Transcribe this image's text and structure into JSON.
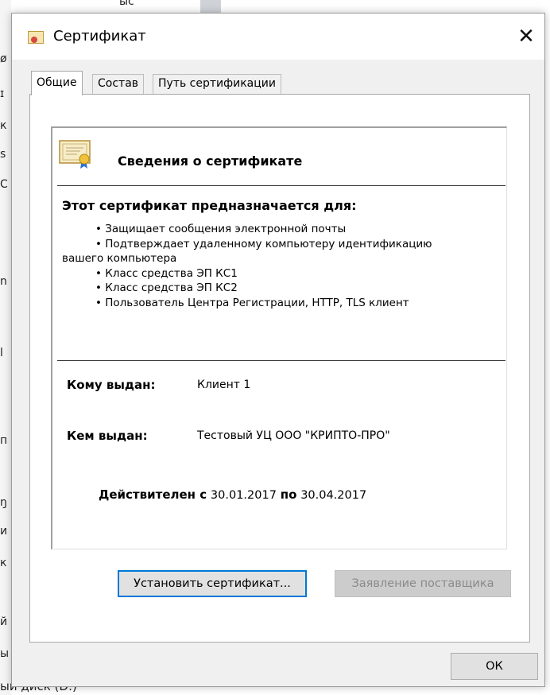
{
  "background": {
    "top_fragment": "ыс",
    "left_fragments": [
      "ø",
      "ɪ",
      "к",
      "s",
      "C",
      "n",
      "l",
      "п",
      "ŋ",
      "и",
      "к",
      "й",
      "ы"
    ],
    "bottom_text": "ый диск (D:)"
  },
  "dialog": {
    "title": "Сертификат",
    "icon": "certificate-icon",
    "close_glyph": "✕"
  },
  "tabs": [
    {
      "label": "Общие",
      "active": true
    },
    {
      "label": "Состав",
      "active": false
    },
    {
      "label": "Путь сертификации",
      "active": false
    }
  ],
  "info": {
    "heading": "Сведения о сертификате",
    "purpose_heading": "Этот сертификат предназначается для:",
    "purposes": [
      "• Защищает сообщения электронной почты",
      "• Подтверждает удаленному компьютеру идентификацию",
      "вашего компьютера",
      "• Класс средства ЭП КС1",
      "• Класс средства ЭП КС2",
      "• Пользователь Центра Регистрации, HTTP, TLS клиент"
    ],
    "issued_to_label": "Кому выдан:",
    "issued_to_value": "Клиент 1",
    "issued_by_label": "Кем выдан:",
    "issued_by_value": "Тестовый УЦ ООО \"КРИПТО-ПРО\"",
    "valid_from_label": "Действителен с",
    "valid_from_value": "30.01.2017",
    "valid_to_label": "по",
    "valid_to_value": "30.04.2017"
  },
  "buttons": {
    "install": "Установить сертификат...",
    "issuer_statement": "Заявление поставщика",
    "ok": "ОК"
  },
  "colors": {
    "dialog_bg": "#f0f0f0",
    "panel_bg": "#ffffff",
    "focus_border": "#0078d7"
  }
}
